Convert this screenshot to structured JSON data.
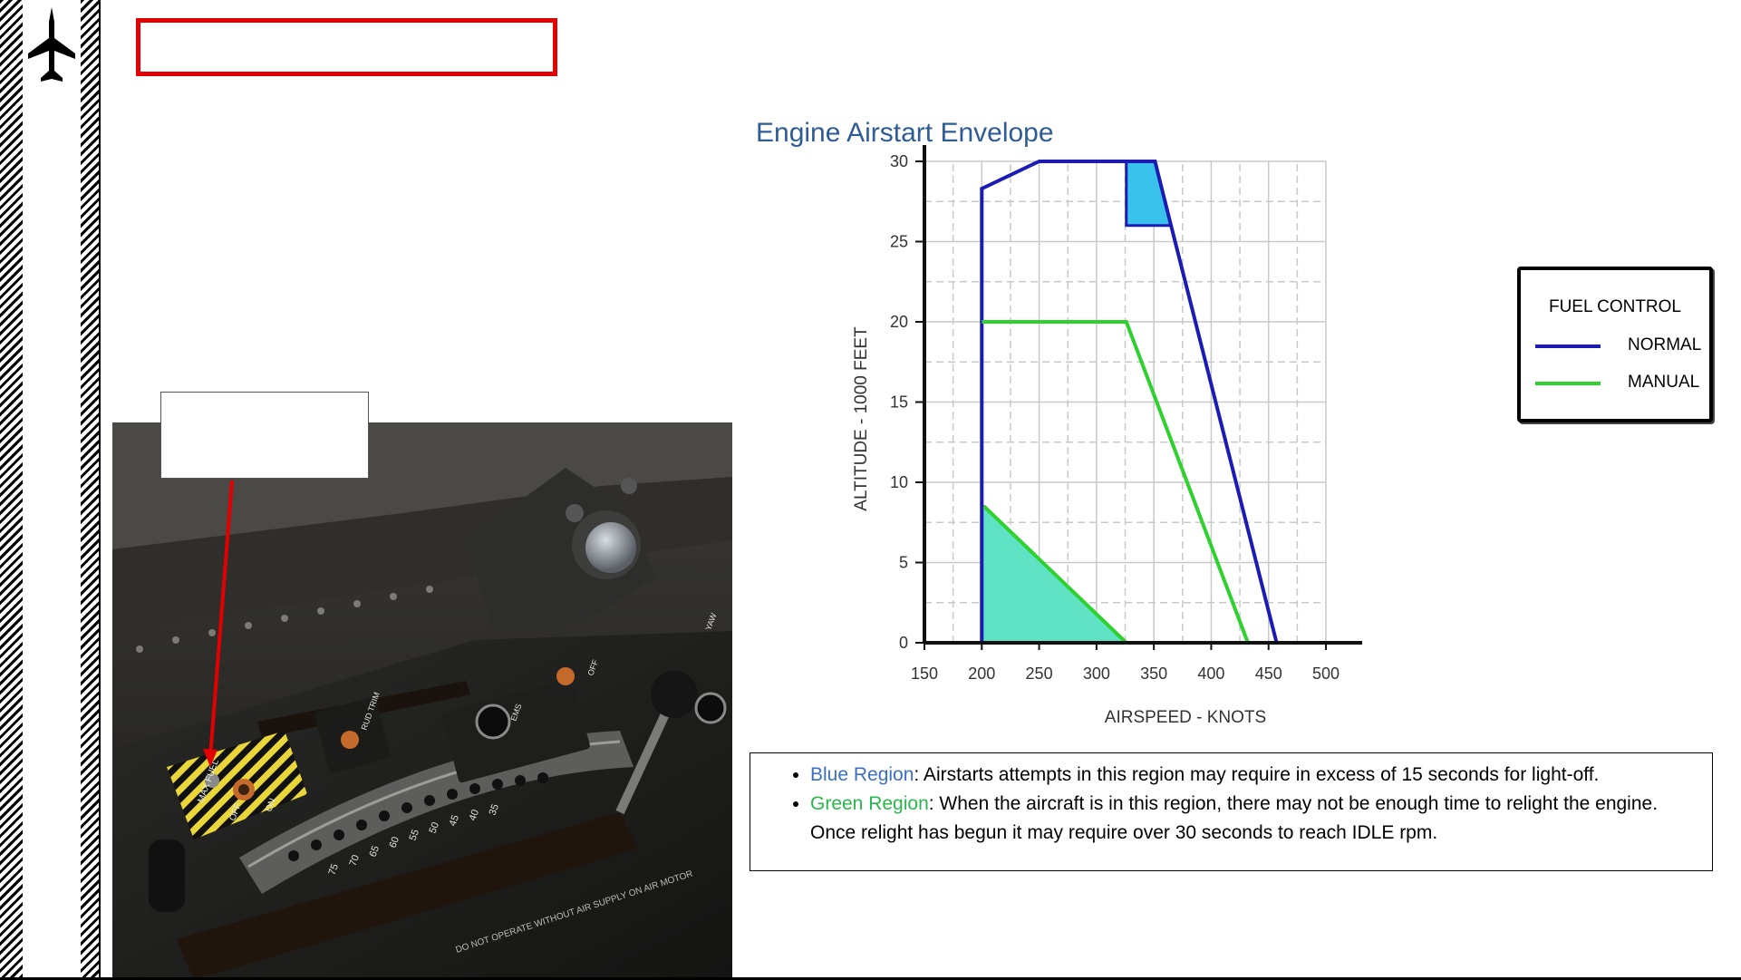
{
  "slide": {
    "title_text": "",
    "callout_text": ""
  },
  "icons": {
    "logo": "jet-aircraft-icon",
    "hatch_color": "#000000",
    "title_frame_color": "#e20000",
    "arrow_color": "#e20000"
  },
  "photo": {
    "description_icon": "cockpit-throttle-panel-image",
    "placards": {
      "fuel_max": "MAX FUEL",
      "off": "OFF",
      "on": "ON",
      "ems": "EMS",
      "yaw": "YAW",
      "rud_trim": "RUD TRIM",
      "scale": [
        "75",
        "70",
        "65",
        "60",
        "55",
        "50",
        "45",
        "40",
        "35"
      ],
      "warning": "DO NOT OPERATE WITHOUT AIR SUPPLY ON AIR MOTOR"
    }
  },
  "chart_data": {
    "type": "line",
    "title": "Engine Airstart Envelope",
    "xlabel": "AIRSPEED - KNOTS",
    "ylabel": "ALTITUDE - 1000 FEET",
    "xlim": [
      150,
      500
    ],
    "ylim": [
      0,
      30
    ],
    "xticks": [
      150,
      200,
      250,
      300,
      350,
      400,
      450,
      500
    ],
    "yticks": [
      0,
      5,
      10,
      15,
      20,
      25,
      30
    ],
    "grid": true,
    "legend_title": "FUEL CONTROL",
    "legend_position": "right",
    "series": [
      {
        "name": "NORMAL",
        "color": "#1c1cb4",
        "points": [
          [
            200,
            0
          ],
          [
            200,
            28.3
          ],
          [
            250,
            30
          ],
          [
            351,
            30
          ],
          [
            365,
            26
          ],
          [
            457,
            0
          ]
        ]
      },
      {
        "name": "MANUAL",
        "color": "#2ed12e",
        "points": [
          [
            200,
            20
          ],
          [
            326,
            20
          ],
          [
            432,
            0
          ]
        ]
      },
      {
        "name": "",
        "color": "#2ed12e",
        "points": [
          [
            202,
            8.5
          ],
          [
            326,
            0
          ]
        ]
      }
    ],
    "regions": [
      {
        "name": "blue",
        "fill": "#39c3ec",
        "stroke": "#1c1cb4",
        "points": [
          [
            326,
            30
          ],
          [
            351,
            30
          ],
          [
            365,
            26
          ],
          [
            326,
            26
          ]
        ]
      },
      {
        "name": "green",
        "fill": "#5fe3c4",
        "stroke": "#2ed12e",
        "points": [
          [
            200,
            0
          ],
          [
            200,
            8.5
          ],
          [
            202,
            8.5
          ],
          [
            326,
            0
          ]
        ]
      }
    ]
  },
  "notes": {
    "items": [
      {
        "highlight": "Blue Region",
        "text": ": Airstarts attempts in this region may require in excess of 15 seconds for light-off."
      },
      {
        "highlight": "Green Region",
        "text": ": When the aircraft is in this region, there may not be enough time to relight the engine. Once relight has begun it may require over 30 seconds to reach IDLE rpm."
      }
    ]
  }
}
